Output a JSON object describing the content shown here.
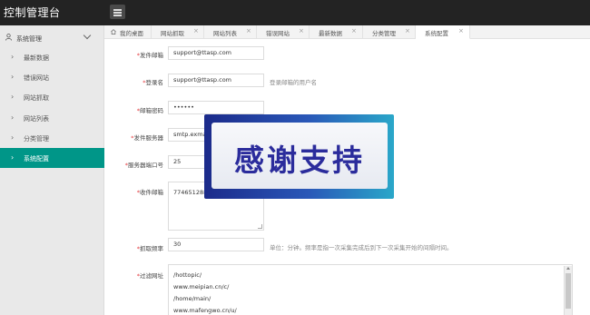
{
  "app": {
    "title": "控制管理台"
  },
  "sidebar": {
    "group_label": "系统管理",
    "items": [
      {
        "label": "最新数据",
        "active": false
      },
      {
        "label": "错误网站",
        "active": false
      },
      {
        "label": "网站抓取",
        "active": false
      },
      {
        "label": "网站列表",
        "active": false
      },
      {
        "label": "分类管理",
        "active": false
      },
      {
        "label": "系统配置",
        "active": true
      }
    ]
  },
  "tabs": [
    {
      "label": "我的桌面"
    },
    {
      "label": "网站抓取"
    },
    {
      "label": "网站列表"
    },
    {
      "label": "错误网站"
    },
    {
      "label": "最新数据"
    },
    {
      "label": "分类管理"
    },
    {
      "label": "系统配置"
    }
  ],
  "form": {
    "sender_email": {
      "label": "发件邮箱",
      "value": "support@ttasp.com"
    },
    "login_name": {
      "label": "登录名",
      "value": "support@ttasp.com",
      "hint": "登录邮箱的用户名"
    },
    "email_password": {
      "label": "邮箱密码",
      "value": "••••••"
    },
    "smtp_server": {
      "label": "发件服务器",
      "value": "smtp.exmail"
    },
    "server_port": {
      "label": "服务器端口号",
      "value": "25"
    },
    "recipient_email": {
      "label": "收件邮箱",
      "value": "774651288"
    },
    "crawl_interval": {
      "label": "抓取频率",
      "value": "30",
      "hint": "单位：分钟。频率是指一次采集完成后到下一次采集开始的间隔时间。"
    },
    "filter_urls": {
      "label": "过滤网址",
      "lines": [
        "/hottopic/",
        "www.meipian.cn/c/",
        "/home/main/",
        "www.mafengwo.cn/u/"
      ]
    }
  },
  "overlay": {
    "text": "感谢支持"
  }
}
